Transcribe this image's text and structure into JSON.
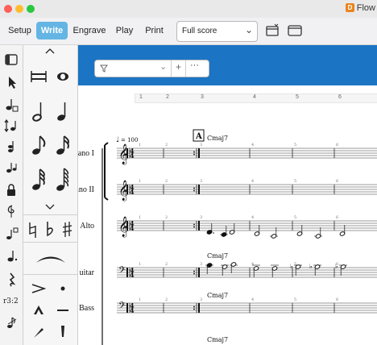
{
  "window": {
    "title": "Flow",
    "app_badge": "D"
  },
  "modes": {
    "setup": "Setup",
    "write": "Write",
    "engrave": "Engrave",
    "play": "Play",
    "print": "Print"
  },
  "layout_select": {
    "value": "Full score"
  },
  "score": {
    "tempo": "= 100",
    "rehearsal_mark": "A",
    "bar_numbers": [
      "1",
      "2",
      "3",
      "4",
      "5",
      "6"
    ],
    "instruments": [
      "Piano I",
      "Piano II",
      "Alto",
      "Guitar",
      "Bass"
    ],
    "instruments_visible": [
      "rano I",
      "ano II",
      "Alto",
      "uitar",
      "Bass"
    ],
    "chord_symbols": [
      "Cmaj7",
      "Cmaj7",
      "Cmaj7",
      "Cmaj7"
    ],
    "time_signature": "4/4"
  },
  "colors": {
    "accent": "#64b5e3",
    "score_band": "#1b74c4",
    "app_badge": "#e8851f"
  },
  "icons": [
    "search-filter-icon",
    "add-icon",
    "more-icon",
    "panel-toggle-icon",
    "select-tool-icon",
    "note-input-icon",
    "lock-icon"
  ]
}
